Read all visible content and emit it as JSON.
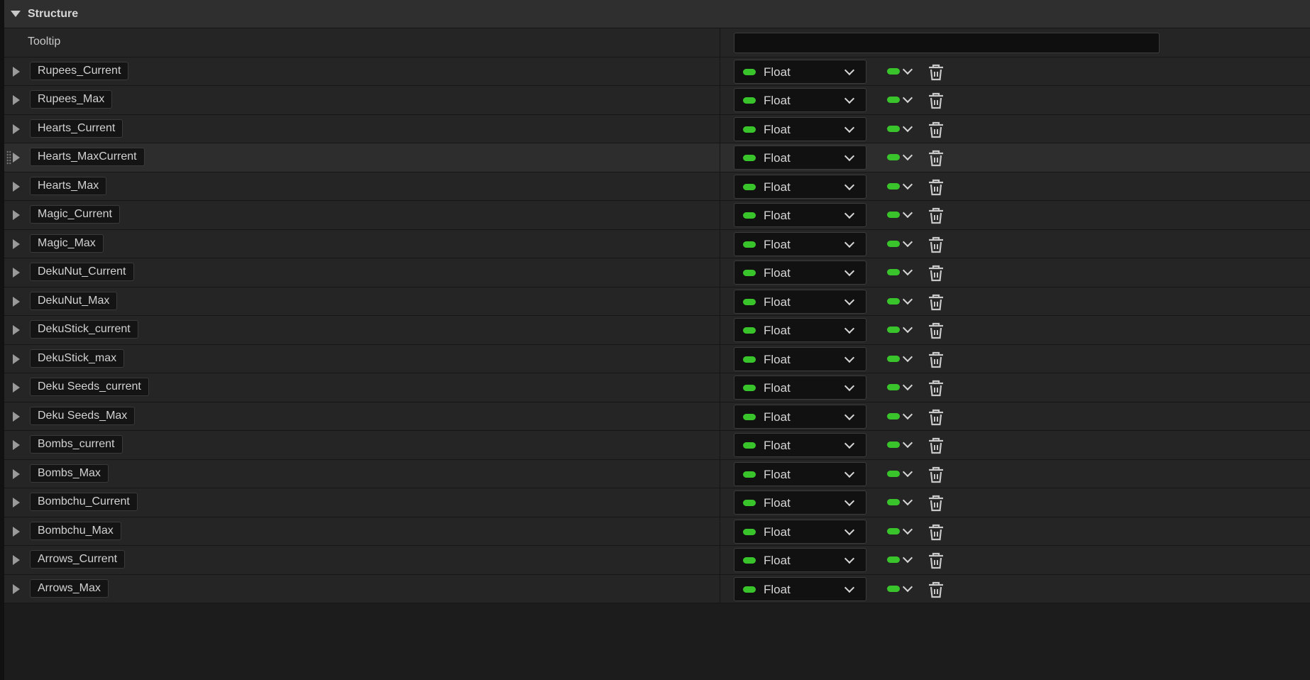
{
  "section": {
    "title": "Structure"
  },
  "tooltip": {
    "label": "Tooltip",
    "value": ""
  },
  "pin_color": "#3ac42b",
  "icons": {
    "collapse": "triangle-down-icon",
    "expand": "triangle-right-icon",
    "delete": "trash-icon",
    "drag": "drag-grip-icon",
    "pin": "float-pin-icon",
    "dropdown": "chevron-down-icon"
  },
  "variables": [
    {
      "name": "Rupees_Current",
      "type": "Float"
    },
    {
      "name": "Rupees_Max",
      "type": "Float"
    },
    {
      "name": "Hearts_Current",
      "type": "Float"
    },
    {
      "name": "Hearts_MaxCurrent",
      "type": "Float"
    },
    {
      "name": "Hearts_Max",
      "type": "Float"
    },
    {
      "name": "Magic_Current",
      "type": "Float"
    },
    {
      "name": "Magic_Max",
      "type": "Float"
    },
    {
      "name": "DekuNut_Current",
      "type": "Float"
    },
    {
      "name": "DekuNut_Max",
      "type": "Float"
    },
    {
      "name": "DekuStick_current",
      "type": "Float"
    },
    {
      "name": "DekuStick_max",
      "type": "Float"
    },
    {
      "name": "Deku Seeds_current",
      "type": "Float"
    },
    {
      "name": "Deku Seeds_Max",
      "type": "Float"
    },
    {
      "name": "Bombs_current",
      "type": "Float"
    },
    {
      "name": "Bombs_Max",
      "type": "Float"
    },
    {
      "name": "Bombchu_Current",
      "type": "Float"
    },
    {
      "name": "Bombchu_Max",
      "type": "Float"
    },
    {
      "name": "Arrows_Current",
      "type": "Float"
    },
    {
      "name": "Arrows_Max",
      "type": "Float"
    }
  ]
}
